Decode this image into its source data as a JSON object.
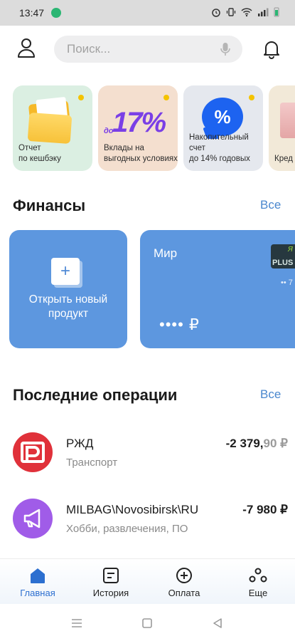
{
  "status_bar": {
    "time": "13:47"
  },
  "header": {
    "search_placeholder": "Поиск..."
  },
  "stories": [
    {
      "title": "Отчет\nпо кешбэку",
      "has_dot": true
    },
    {
      "title": "Вклады на\nвыгодных условиях",
      "has_dot": true,
      "promo": "17%",
      "promo_prefix": "до"
    },
    {
      "title": "Накопительный счет\nдо 14% годовых",
      "has_dot": true,
      "promo": "%"
    },
    {
      "title": "Кред",
      "has_dot": false
    }
  ],
  "finance": {
    "title": "Финансы",
    "all_label": "Все",
    "new_product_label": "Открыть новый\nпродукт",
    "new_product_icon": "+",
    "card": {
      "name": "Мир",
      "badge_text": "PLUS",
      "badge_letter": "Я",
      "number_suffix": "•• 7",
      "balance_mask": "•••• ₽"
    }
  },
  "operations": {
    "title": "Последние операции",
    "all_label": "Все",
    "items": [
      {
        "name": "РЖД",
        "category": "Транспорт",
        "amount_main": "-2 379,",
        "amount_cents": "90 ₽",
        "icon": "rzd-logo-icon",
        "color": "#e0313a"
      },
      {
        "name": "MILBAG\\Novosibirsk\\RU",
        "category": "Хобби, развлечения, ПО",
        "amount_main": "-7 980 ₽",
        "amount_cents": "",
        "icon": "megaphone-icon",
        "color": "#a05ce8"
      }
    ]
  },
  "bottom_nav": [
    {
      "label": "Главная",
      "icon": "home-icon",
      "active": true
    },
    {
      "label": "История",
      "icon": "history-icon",
      "active": false
    },
    {
      "label": "Оплата",
      "icon": "payment-plus-icon",
      "active": false
    },
    {
      "label": "Еще",
      "icon": "more-icon",
      "active": false
    }
  ],
  "colors": {
    "accent": "#2c6fd0",
    "card_blue": "#5d97df",
    "link": "#4a87ce"
  }
}
